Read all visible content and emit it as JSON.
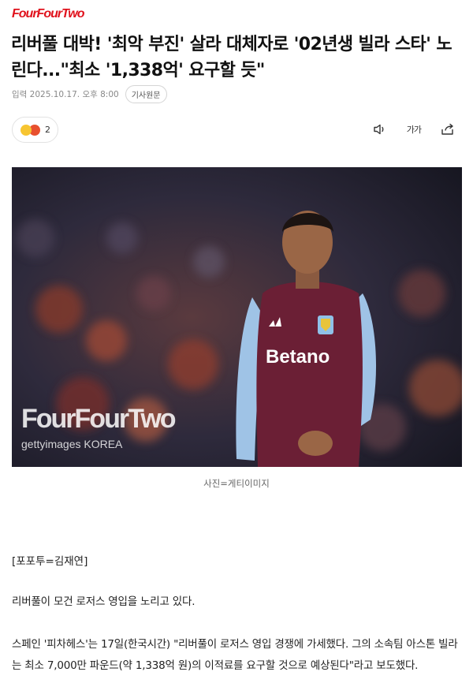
{
  "site": {
    "logo_text": "FourFourTwo",
    "brand_color": "#e0121c"
  },
  "article": {
    "headline": "리버풀 대박! '최악 부진' 살라 대체자로 '02년생 빌라 스타' 노린다...\"최소 '1,338억' 요구할 듯\"",
    "published": "입력 2025.10.17. 오후 8:00",
    "source_button": "기사원문",
    "reaction_count": "2",
    "photo_caption": "사진=게티이미지",
    "photo_watermark_brand": "FourFourTwo",
    "photo_watermark_agency": "gettyimages KOREA",
    "jersey_sponsor": "Betano",
    "byline": "[포포투=김재연]",
    "paragraphs": [
      "리버풀이 모건 로저스 영입을 노리고 있다.",
      "스페인 '피차헤스'는 17일(한국시간) \"리버풀이 로저스 영입 경쟁에 가세했다. 그의 소속팀 아스톤 빌라는 최소 7,000만 파운드(약 1,338억 원)의 이적료를 요구할 것으로 예상된다\"라고 보도했다."
    ]
  },
  "toolbar": {
    "tts_icon": "speaker-icon",
    "font_size_label": "가가",
    "share_icon": "share-icon"
  },
  "icons": {
    "reaction": "emoji-reaction-icon"
  }
}
